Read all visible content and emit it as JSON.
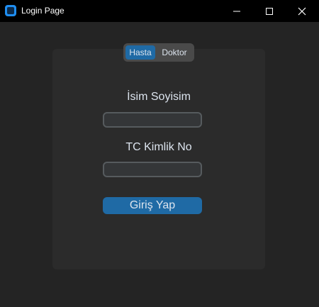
{
  "window": {
    "title": "Login Page",
    "icon": "app-icon",
    "controls": {
      "minimize_icon": "minimize-icon",
      "maximize_icon": "maximize-icon",
      "close_icon": "close-icon"
    }
  },
  "role_selector": {
    "options": [
      "Hasta",
      "Doktor"
    ],
    "selected": "Hasta"
  },
  "form": {
    "name_label": "İsim Soyisim",
    "name_value": "",
    "tc_label": "TC Kimlik No",
    "tc_value": "",
    "submit_label": "Giriş Yap"
  },
  "colors": {
    "accent": "#1f6aa5",
    "background": "#242424",
    "frame": "#2b2b2b",
    "titlebar": "#000000",
    "text": "#dce4ee"
  }
}
